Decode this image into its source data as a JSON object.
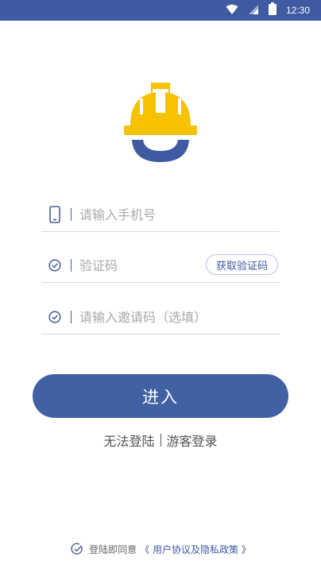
{
  "status_bar": {
    "time": "12:30",
    "icons": [
      "wifi-icon",
      "signal-icon",
      "battery-icon"
    ]
  },
  "logo": {
    "name": "helmet-logo",
    "colors": {
      "helmet": "#f6c200",
      "smile": "#3f5aa0"
    }
  },
  "form": {
    "phone": {
      "placeholder": "请输入手机号",
      "icon": "phone-icon"
    },
    "code": {
      "placeholder": "验证码",
      "icon": "check-circle-icon",
      "button_label": "获取验证码"
    },
    "invite": {
      "placeholder": "请输入邀请码（选填）",
      "icon": "check-circle-icon"
    }
  },
  "actions": {
    "enter_label": "进入",
    "cannot_login": "无法登陆",
    "guest_login": "游客登录"
  },
  "agreement": {
    "prefix": "登陆即同意",
    "policy_link": "《 用户协议及隐私政策 》"
  },
  "colors": {
    "primary": "#3f5aa0",
    "placeholder": "#a9a9a9"
  }
}
